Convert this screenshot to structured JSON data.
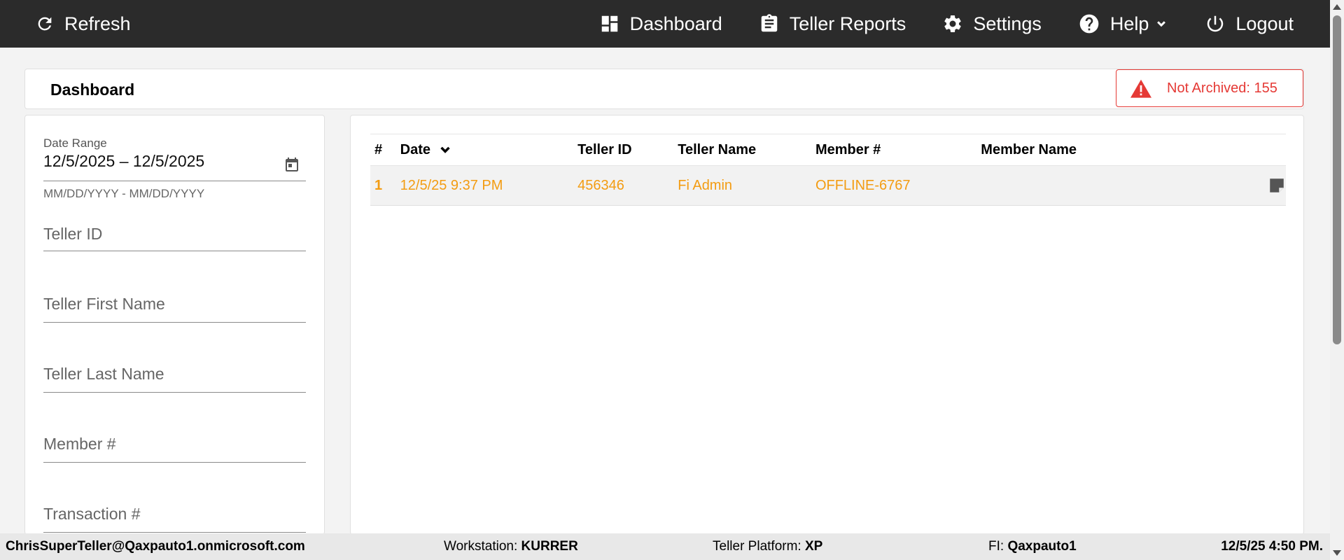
{
  "navbar": {
    "refresh_label": "Refresh",
    "items": [
      {
        "label": "Dashboard",
        "icon": "dashboard-icon"
      },
      {
        "label": "Teller Reports",
        "icon": "clipboard-icon"
      },
      {
        "label": "Settings",
        "icon": "gear-icon"
      },
      {
        "label": "Help",
        "icon": "help-icon"
      },
      {
        "label": "Logout",
        "icon": "power-icon"
      }
    ]
  },
  "header": {
    "title": "Dashboard",
    "alert_label": "Not Archived: 155",
    "alert_color": "#e53935"
  },
  "filters": {
    "date_range_label": "Date Range",
    "date_range_value": "12/5/2025 – 12/5/2025",
    "date_range_hint": "MM/DD/YYYY - MM/DD/YYYY",
    "teller_id_placeholder": "Teller ID",
    "teller_first_name_placeholder": "Teller First Name",
    "teller_last_name_placeholder": "Teller Last Name",
    "member_number_placeholder": "Member #",
    "transaction_number_placeholder": "Transaction #"
  },
  "table": {
    "columns": [
      "#",
      "Date",
      "Teller ID",
      "Teller Name",
      "Member #",
      "Member Name"
    ],
    "rows": [
      {
        "num": "1",
        "date": "12/5/25 9:37 PM",
        "teller_id": "456346",
        "teller_name": "Fi Admin",
        "member_number": "OFFLINE-6767",
        "member_name": ""
      }
    ],
    "row_color": "#f39c12"
  },
  "footer": {
    "user": "ChrisSuperTeller@Qaxpauto1.onmicrosoft.com",
    "workstation_label": "Workstation: ",
    "workstation_value": "KURRER",
    "platform_label": "Teller Platform: ",
    "platform_value": "XP",
    "fi_label": "FI: ",
    "fi_value": "Qaxpauto1",
    "datetime": "12/5/25 4:50 PM."
  }
}
